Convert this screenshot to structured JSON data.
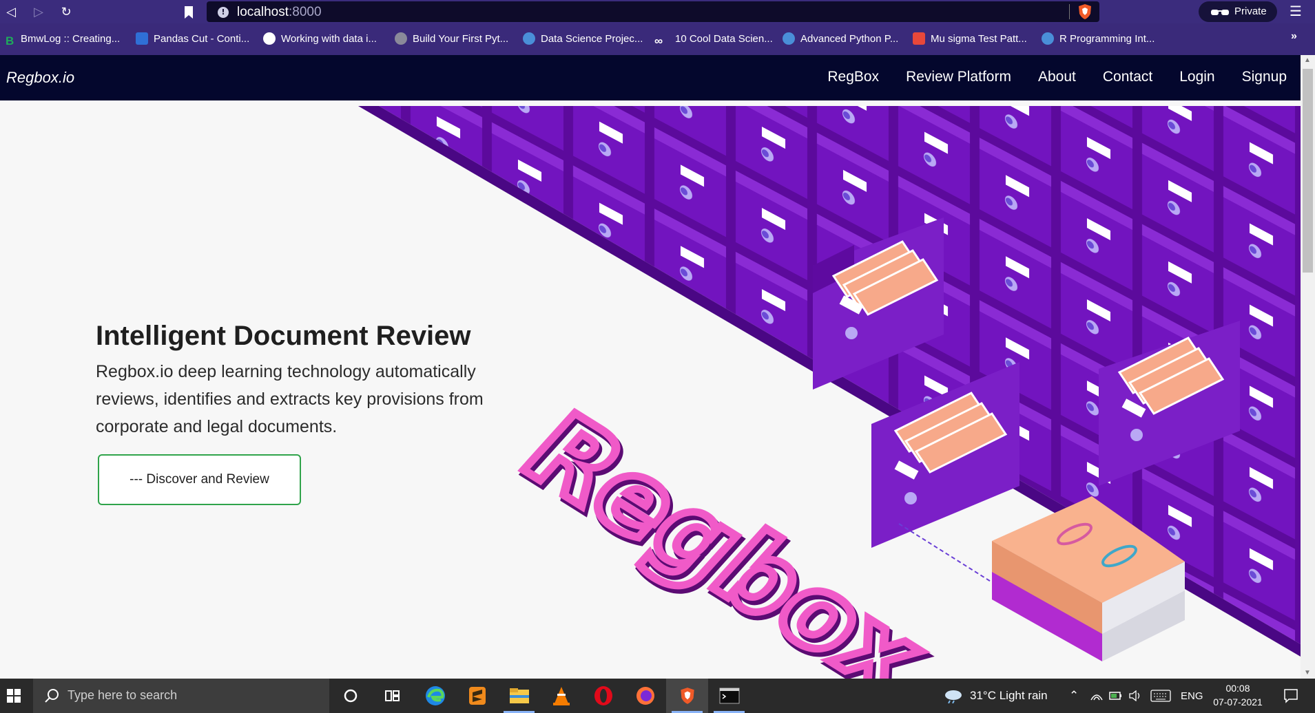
{
  "browser": {
    "address_host": "localhost",
    "address_port": ":8000",
    "private_label": "Private",
    "more_bookmarks": "»",
    "bookmarks": [
      {
        "label": "BmwLog :: Creating...",
        "icon": "b-icon",
        "color": "#1faa5c"
      },
      {
        "label": "Pandas Cut - Conti...",
        "icon": "chart-icon",
        "color": "#2f6fd6"
      },
      {
        "label": "Working with data i...",
        "icon": "globe-icon",
        "color": "#ffffff"
      },
      {
        "label": "Build Your First Pyt...",
        "icon": "hex-icon",
        "color": "#8a8a9a"
      },
      {
        "label": "Data Science Projec...",
        "icon": "blog-icon",
        "color": "#4a8fd8"
      },
      {
        "label": "10 Cool Data Scien...",
        "icon": "infinity-icon",
        "color": "#ffffff"
      },
      {
        "label": "Advanced Python P...",
        "icon": "blog-icon",
        "color": "#4a8fd8"
      },
      {
        "label": "Mu sigma Test Patt...",
        "icon": "grid-icon",
        "color": "#e8483a"
      },
      {
        "label": "R Programming Int...",
        "icon": "blog-icon",
        "color": "#4a8fd8"
      }
    ]
  },
  "site": {
    "brand": "Regbox.io",
    "nav": [
      "RegBox",
      "Review Platform",
      "About",
      "Contact",
      "Login",
      "Signup"
    ]
  },
  "hero": {
    "title": "Intelligent Document Review",
    "text": "Regbox.io deep learning technology automatically reviews, identifies and extracts key provisions from corporate and legal documents.",
    "cta": "--- Discover and Review",
    "illustration_word": "Regbox"
  },
  "taskbar": {
    "search_placeholder": "Type here to search",
    "weather": "31°C  Light rain",
    "language": "ENG",
    "time": "00:08",
    "date": "07-07-2021"
  },
  "colors": {
    "browser_bg": "#3a2a7a",
    "site_nav": "#04072d",
    "cabinet_purple": "#6a0dad",
    "cta_border": "#2fa34a",
    "regbox_pink": "#f05ac8"
  }
}
